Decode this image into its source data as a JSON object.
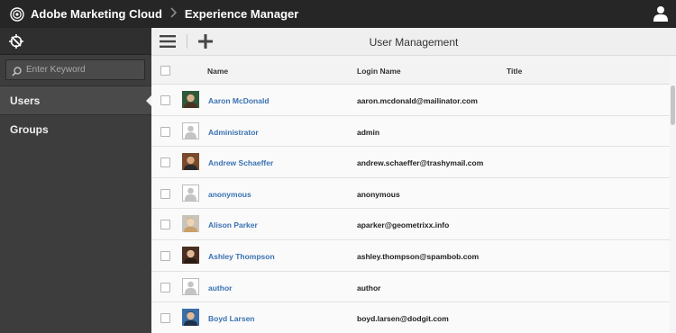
{
  "header": {
    "brand": "Adobe Marketing Cloud",
    "separator": ">",
    "product": "Experience Manager"
  },
  "sidebar": {
    "search_placeholder": "Enter Keyword",
    "items": [
      {
        "label": "Users",
        "active": true
      },
      {
        "label": "Groups",
        "active": false
      }
    ]
  },
  "toolbar": {
    "title": "User Management"
  },
  "table": {
    "columns": [
      "Name",
      "Login Name",
      "Title"
    ],
    "rows": [
      {
        "name": "Aaron McDonald",
        "login": "aaron.mcdonald@mailinator.com",
        "avatar": "photo-avatar"
      },
      {
        "name": "Administrator",
        "login": "admin",
        "avatar": "default-avatar"
      },
      {
        "name": "Andrew Schaeffer",
        "login": "andrew.schaeffer@trashymail.com",
        "avatar": "photo-avatar"
      },
      {
        "name": "anonymous",
        "login": "anonymous",
        "avatar": "default-avatar"
      },
      {
        "name": "Alison Parker",
        "login": "aparker@geometrixx.info",
        "avatar": "photo-avatar"
      },
      {
        "name": "Ashley Thompson",
        "login": "ashley.thompson@spambob.com",
        "avatar": "photo-avatar"
      },
      {
        "name": "author",
        "login": "author",
        "avatar": "default-avatar"
      },
      {
        "name": "Boyd Larsen",
        "login": "boyd.larsen@dodgit.com",
        "avatar": "photo-avatar"
      }
    ]
  },
  "colors": {
    "topbar": "#262626",
    "rail": "#3d3d3d",
    "link": "#3a72b3"
  }
}
